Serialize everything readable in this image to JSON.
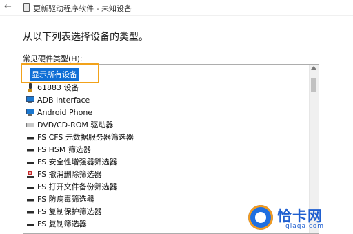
{
  "titlebar": {
    "back_icon": "back-arrow-icon",
    "title": "更新驱动程序软件 - 未知设备"
  },
  "heading": "从以下列表选择设备的类型。",
  "list": {
    "label": "常见硬件类型(H):",
    "items": [
      {
        "label": "显示所有设备",
        "icon": "none",
        "selected": true
      },
      {
        "label": "61883 设备",
        "icon": "usb-icon"
      },
      {
        "label": "ADB Interface",
        "icon": "monitor-icon"
      },
      {
        "label": "Android Phone",
        "icon": "monitor-icon"
      },
      {
        "label": "DVD/CD-ROM 驱动器",
        "icon": "drive-icon"
      },
      {
        "label": "FS CFS 元数据服务器筛选器",
        "icon": "filter-icon"
      },
      {
        "label": "FS HSM 筛选器",
        "icon": "filter-icon"
      },
      {
        "label": "FS 安全性增强器筛选器",
        "icon": "filter-icon"
      },
      {
        "label": "FS 撤消删除筛选器",
        "icon": "red-icon"
      },
      {
        "label": "FS 打开文件备份筛选器",
        "icon": "filter-icon"
      },
      {
        "label": "FS 防病毒筛选器",
        "icon": "filter-icon"
      },
      {
        "label": "FS 复制保护筛选器",
        "icon": "filter-icon"
      },
      {
        "label": "FS 复制筛选器",
        "icon": "filter-icon"
      }
    ]
  },
  "watermark": {
    "text": "恰卡网",
    "sub": "qiaqa.com"
  },
  "colors": {
    "selection": "#0f6fd6",
    "highlight_box": "#f2a21a"
  }
}
